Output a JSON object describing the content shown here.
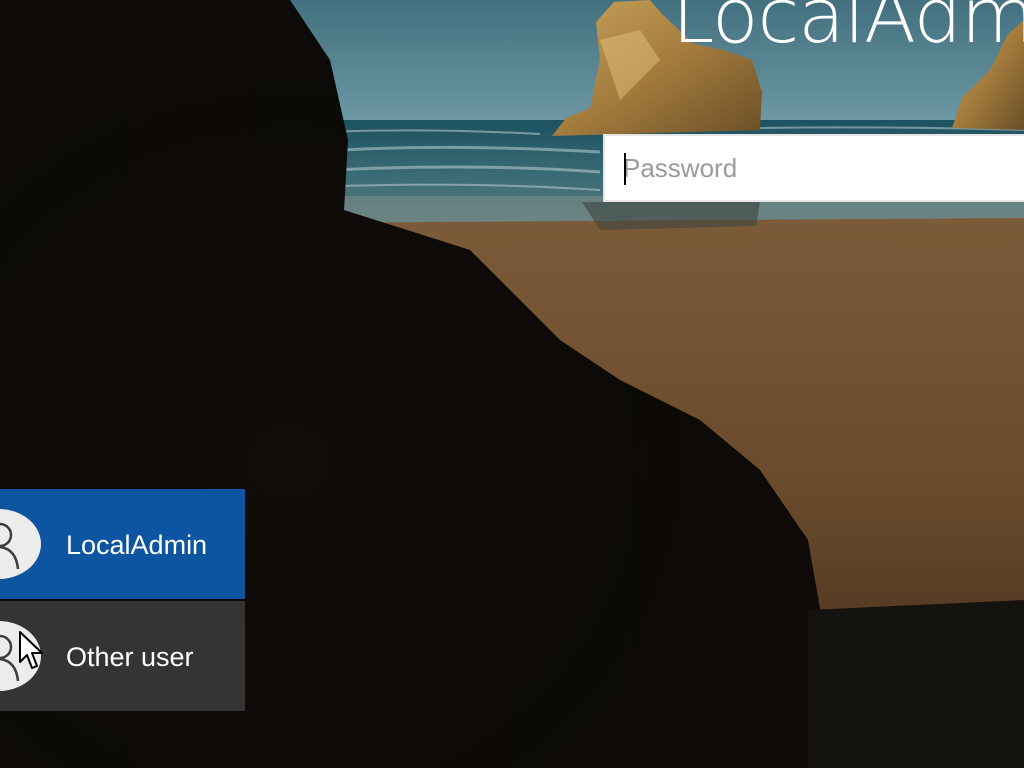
{
  "lock_screen": {
    "account_title": "LocalAdmin",
    "password_placeholder": "Password",
    "password_value": ""
  },
  "user_switcher": {
    "users": [
      {
        "name": "LocalAdmin",
        "selected": true,
        "avatar_icon": "person-outline-icon"
      },
      {
        "name": "Other user",
        "selected": false,
        "avatar_icon": "person-outline-icon"
      }
    ]
  },
  "theme": {
    "selected_tile_color": "#0d55a0",
    "unselected_tile_color": "#3a3a3a",
    "avatar_background": "#ececec"
  }
}
